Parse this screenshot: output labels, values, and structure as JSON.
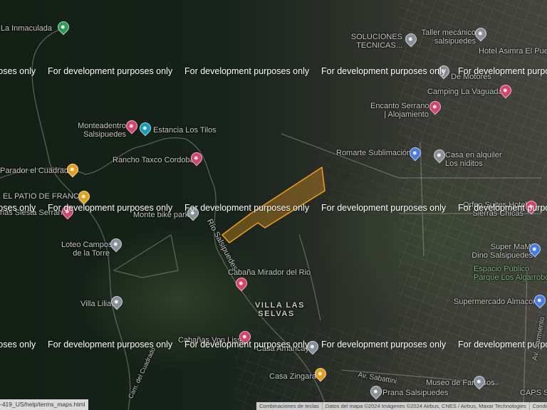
{
  "map": {
    "type": "satellite",
    "polygon_color": "#f29d1f"
  },
  "watermark": "For development purposes only",
  "labels": [
    {
      "text": "La Inmaculada",
      "pin": "#2e9a55"
    },
    {
      "text": "SOLUCIONES\nTECNICAS...",
      "pin": "#8a9099"
    },
    {
      "text": "Taller mecánico\nsalsipuedes",
      "pin": "#8a9099"
    },
    {
      "text": "Hotel Asimra El Pueblo",
      "pin": ""
    },
    {
      "text": "De Motores",
      "pin": "#8a9099"
    },
    {
      "text": "Camping La Vaguada",
      "pin": "#d3456e"
    },
    {
      "text": "Encanto Serrano\n| Alojamiento",
      "pin": "#d3456e"
    },
    {
      "text": "Romarte Sublimación",
      "pin": "#4a7ce0"
    },
    {
      "text": "Casa en alquiler\nLos niditos",
      "pin": "#8a9099"
    },
    {
      "text": "Monteadentro\nSalsipuedes",
      "pin": "#d3456e"
    },
    {
      "text": "Estancia Los Tilos",
      "pin": "#1a9bb5"
    },
    {
      "text": "Rancho Taxco Cordoba",
      "pin": "#d3456e"
    },
    {
      "text": "Parador el Cuadrado",
      "pin": "#e0a020"
    },
    {
      "text": "EL PATIO DE FRANCO",
      "pin": "#e0a020"
    },
    {
      "text": "nas Siesta Serrana",
      "pin": "#d3456e"
    },
    {
      "text": "Monte bike park",
      "pin": "#8a9099"
    },
    {
      "text": "Loteo Campos\nde la Torre",
      "pin": "#8a9099"
    },
    {
      "text": "Villa Lilia",
      "pin": "#8a9099"
    },
    {
      "text": "Cabaña Mirador del Rio",
      "pin": "#d3456e"
    },
    {
      "text": "VILLA LAS\nSELVAS",
      "pin": ""
    },
    {
      "text": "Cabañas Von Liss",
      "pin": "#d3456e"
    },
    {
      "text": "Casa Amancay",
      "pin": "#8a9099"
    },
    {
      "text": "Casa Zingara",
      "pin": "#e0a020"
    },
    {
      "text": "Museo de Famosos",
      "pin": "#8a9099"
    },
    {
      "text": "Prana Salsipuedes",
      "pin": "#8a9099"
    },
    {
      "text": "CAPS S",
      "pin": ""
    },
    {
      "text": "Orfeo Suites Hotel\nSierras Chicas",
      "pin": "#d3456e"
    },
    {
      "text": "Super MaMi\nDino Salsipuedes",
      "pin": "#4a7ce0"
    },
    {
      "text": "Espacio Público\nParque Los Algarrobos",
      "pin": ""
    },
    {
      "text": "Supermercado Almacor",
      "pin": "#4a7ce0"
    }
  ],
  "roads": {
    "rio": "Río Salsipuedes",
    "sabattini": "Av. Sabattini",
    "sarmiento": "Av. Sarmiento",
    "cuadrado": "Cam. del Cuadrado"
  },
  "footer": {
    "terms_link": "-419_US/help/terms_maps.html",
    "shortcuts": "Combinaciones de teclas",
    "map_data": "Datos del mapa ©2024 Imágenes ©2024 Airbus, CNES / Airbus, Maxar Technologies",
    "conditions": "Condic"
  }
}
